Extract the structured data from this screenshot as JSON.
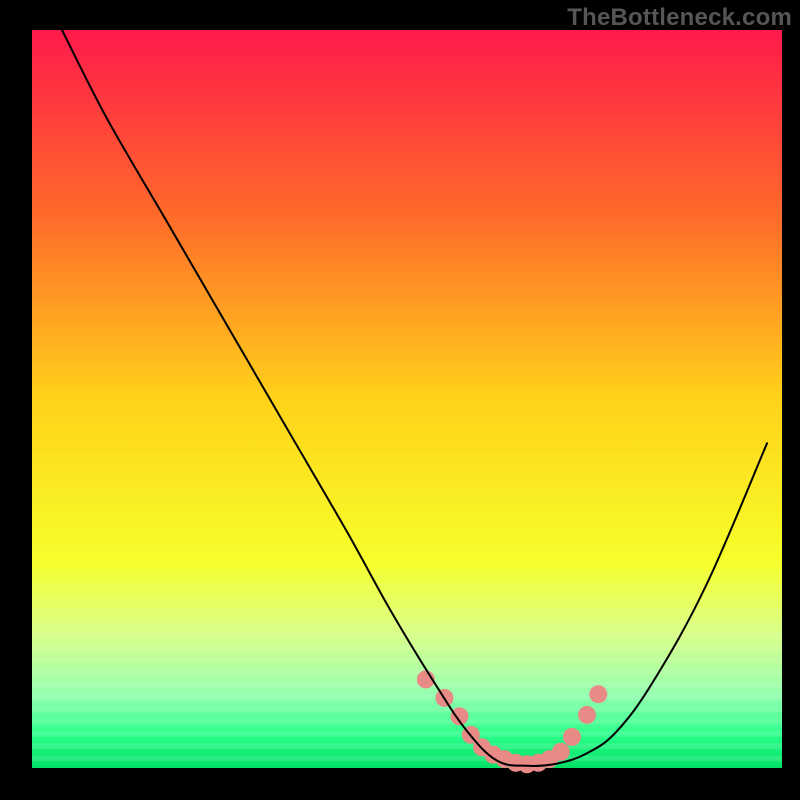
{
  "watermark": "TheBottleneck.com",
  "chart_data": {
    "type": "line",
    "title": "",
    "xlabel": "",
    "ylabel": "",
    "xlim": [
      0,
      100
    ],
    "ylim": [
      0,
      100
    ],
    "grid": false,
    "background_gradient": {
      "stops": [
        {
          "offset": 0.0,
          "color": "#ff1a4b"
        },
        {
          "offset": 0.25,
          "color": "#ff6a2a"
        },
        {
          "offset": 0.5,
          "color": "#ffd21a"
        },
        {
          "offset": 0.72,
          "color": "#f7ff2a"
        },
        {
          "offset": 0.82,
          "color": "#d8ff8a"
        },
        {
          "offset": 0.9,
          "color": "#95ffb0"
        },
        {
          "offset": 0.955,
          "color": "#2bff8a"
        },
        {
          "offset": 1.0,
          "color": "#00e066"
        }
      ]
    },
    "series": [
      {
        "name": "bottleneck-curve",
        "color": "#000000",
        "width": 2,
        "x": [
          4,
          10,
          18,
          26,
          34,
          42,
          48,
          54,
          58,
          62,
          66,
          70,
          74,
          78,
          83,
          90,
          98
        ],
        "y_pct": [
          100,
          88,
          74,
          60,
          46,
          32,
          21,
          11,
          5,
          1,
          0.3,
          0.6,
          2,
          5,
          12,
          25,
          44
        ]
      }
    ],
    "highlight_band": {
      "color": "#e88a86",
      "radius_px": 9,
      "x": [
        52.5,
        55,
        57,
        58.5,
        60,
        61.5,
        63,
        64.5,
        66,
        67.5,
        69,
        70.5,
        72,
        74,
        75.5
      ],
      "y_pct": [
        12,
        9.5,
        7,
        4.5,
        2.8,
        1.8,
        1.2,
        0.7,
        0.5,
        0.7,
        1.2,
        2.2,
        4.2,
        7.2,
        10
      ]
    }
  }
}
